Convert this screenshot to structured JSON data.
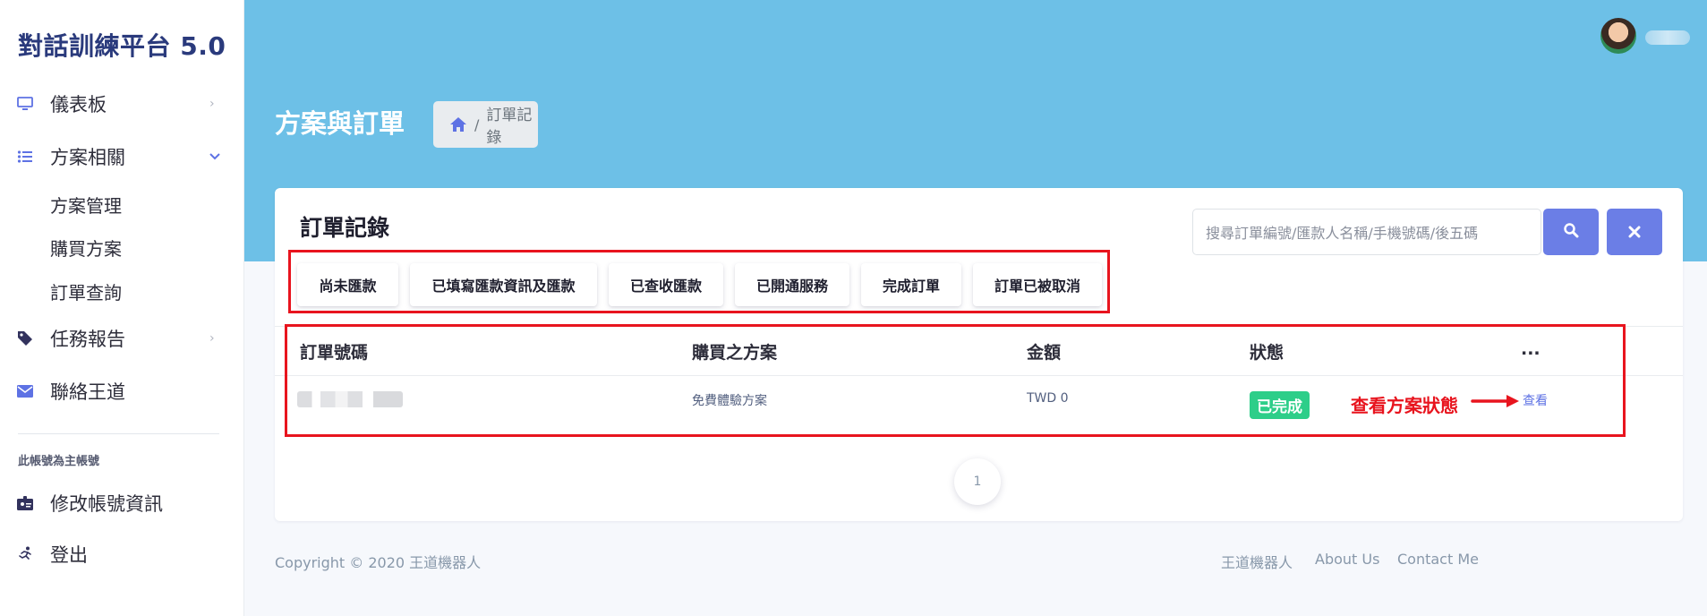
{
  "sidebar": {
    "brand": "對話訓練平台 5.0",
    "items": [
      {
        "label": "儀表板",
        "icon": "monitor-icon"
      },
      {
        "label": "方案相關",
        "icon": "list-icon"
      },
      {
        "label": "任務報告",
        "icon": "tag-icon"
      },
      {
        "label": "聯絡王道",
        "icon": "envelope-icon"
      },
      {
        "label": "修改帳號資訊",
        "icon": "id-card-icon"
      },
      {
        "label": "登出",
        "icon": "running-icon"
      }
    ],
    "sub_items": [
      "方案管理",
      "購買方案",
      "訂單查詢"
    ],
    "note": "此帳號為主帳號"
  },
  "header": {
    "page_title": "方案與訂單",
    "breadcrumb_current": "訂單記錄",
    "breadcrumb_sep": "/"
  },
  "card": {
    "title": "訂單記錄",
    "search_placeholder": "搜尋訂單編號/匯款人名稱/手機號碼/後五碼",
    "filters": [
      "尚未匯款",
      "已填寫匯款資訊及匯款",
      "已查收匯款",
      "已開通服務",
      "完成訂單",
      "訂單已被取消"
    ],
    "columns": [
      "訂單號碼",
      "購買之方案",
      "金額",
      "狀態",
      "..."
    ],
    "rows": [
      {
        "plan": "免費體驗方案",
        "amount": "TWD 0",
        "status": "已完成",
        "action": "查看"
      }
    ],
    "annotation": "查看方案狀態",
    "pages": [
      "1"
    ]
  },
  "footer": {
    "copyright": "Copyright © 2020 王道機器人",
    "links": [
      "王道機器人",
      "About Us",
      "Contact Me"
    ]
  },
  "colors": {
    "header_bg": "#6dc0e7",
    "accent": "#5e72e4",
    "success": "#2dce89",
    "highlight": "#e8141e"
  }
}
